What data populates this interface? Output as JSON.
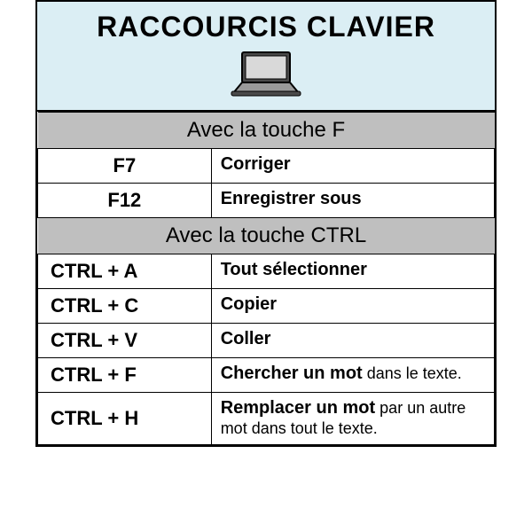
{
  "title": "RACCOURCIS CLAVIER",
  "sections": [
    {
      "heading": "Avec la touche F",
      "rows": [
        {
          "key": "F7",
          "desc_bold": "Corriger",
          "desc_rest": "",
          "key_align": "center"
        },
        {
          "key": "F12",
          "desc_bold": "Enregistrer sous",
          "desc_rest": "",
          "key_align": "center"
        }
      ]
    },
    {
      "heading": "Avec la touche CTRL",
      "rows": [
        {
          "key": "CTRL + A",
          "desc_bold": "Tout sélectionner",
          "desc_rest": "",
          "key_align": "left"
        },
        {
          "key": "CTRL + C",
          "desc_bold": "Copier",
          "desc_rest": "",
          "key_align": "left"
        },
        {
          "key": "CTRL + V",
          "desc_bold": "Coller",
          "desc_rest": "",
          "key_align": "left"
        },
        {
          "key": "CTRL + F",
          "desc_bold": "Chercher un mot",
          "desc_rest": " dans le texte.",
          "key_align": "left"
        },
        {
          "key": "CTRL + H",
          "desc_bold": "Remplacer un mot",
          "desc_rest": " par un autre mot dans tout le texte.",
          "key_align": "left"
        }
      ]
    }
  ]
}
